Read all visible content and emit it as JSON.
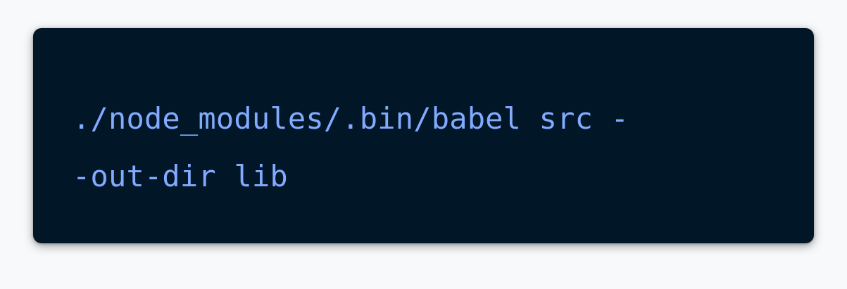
{
  "code_block": {
    "lines": [
      "./node_modules/.bin/babel src -",
      "-out-dir lib"
    ]
  },
  "colors": {
    "background": "#011627",
    "text": "#82aaff",
    "page": "#f8f9fb"
  }
}
